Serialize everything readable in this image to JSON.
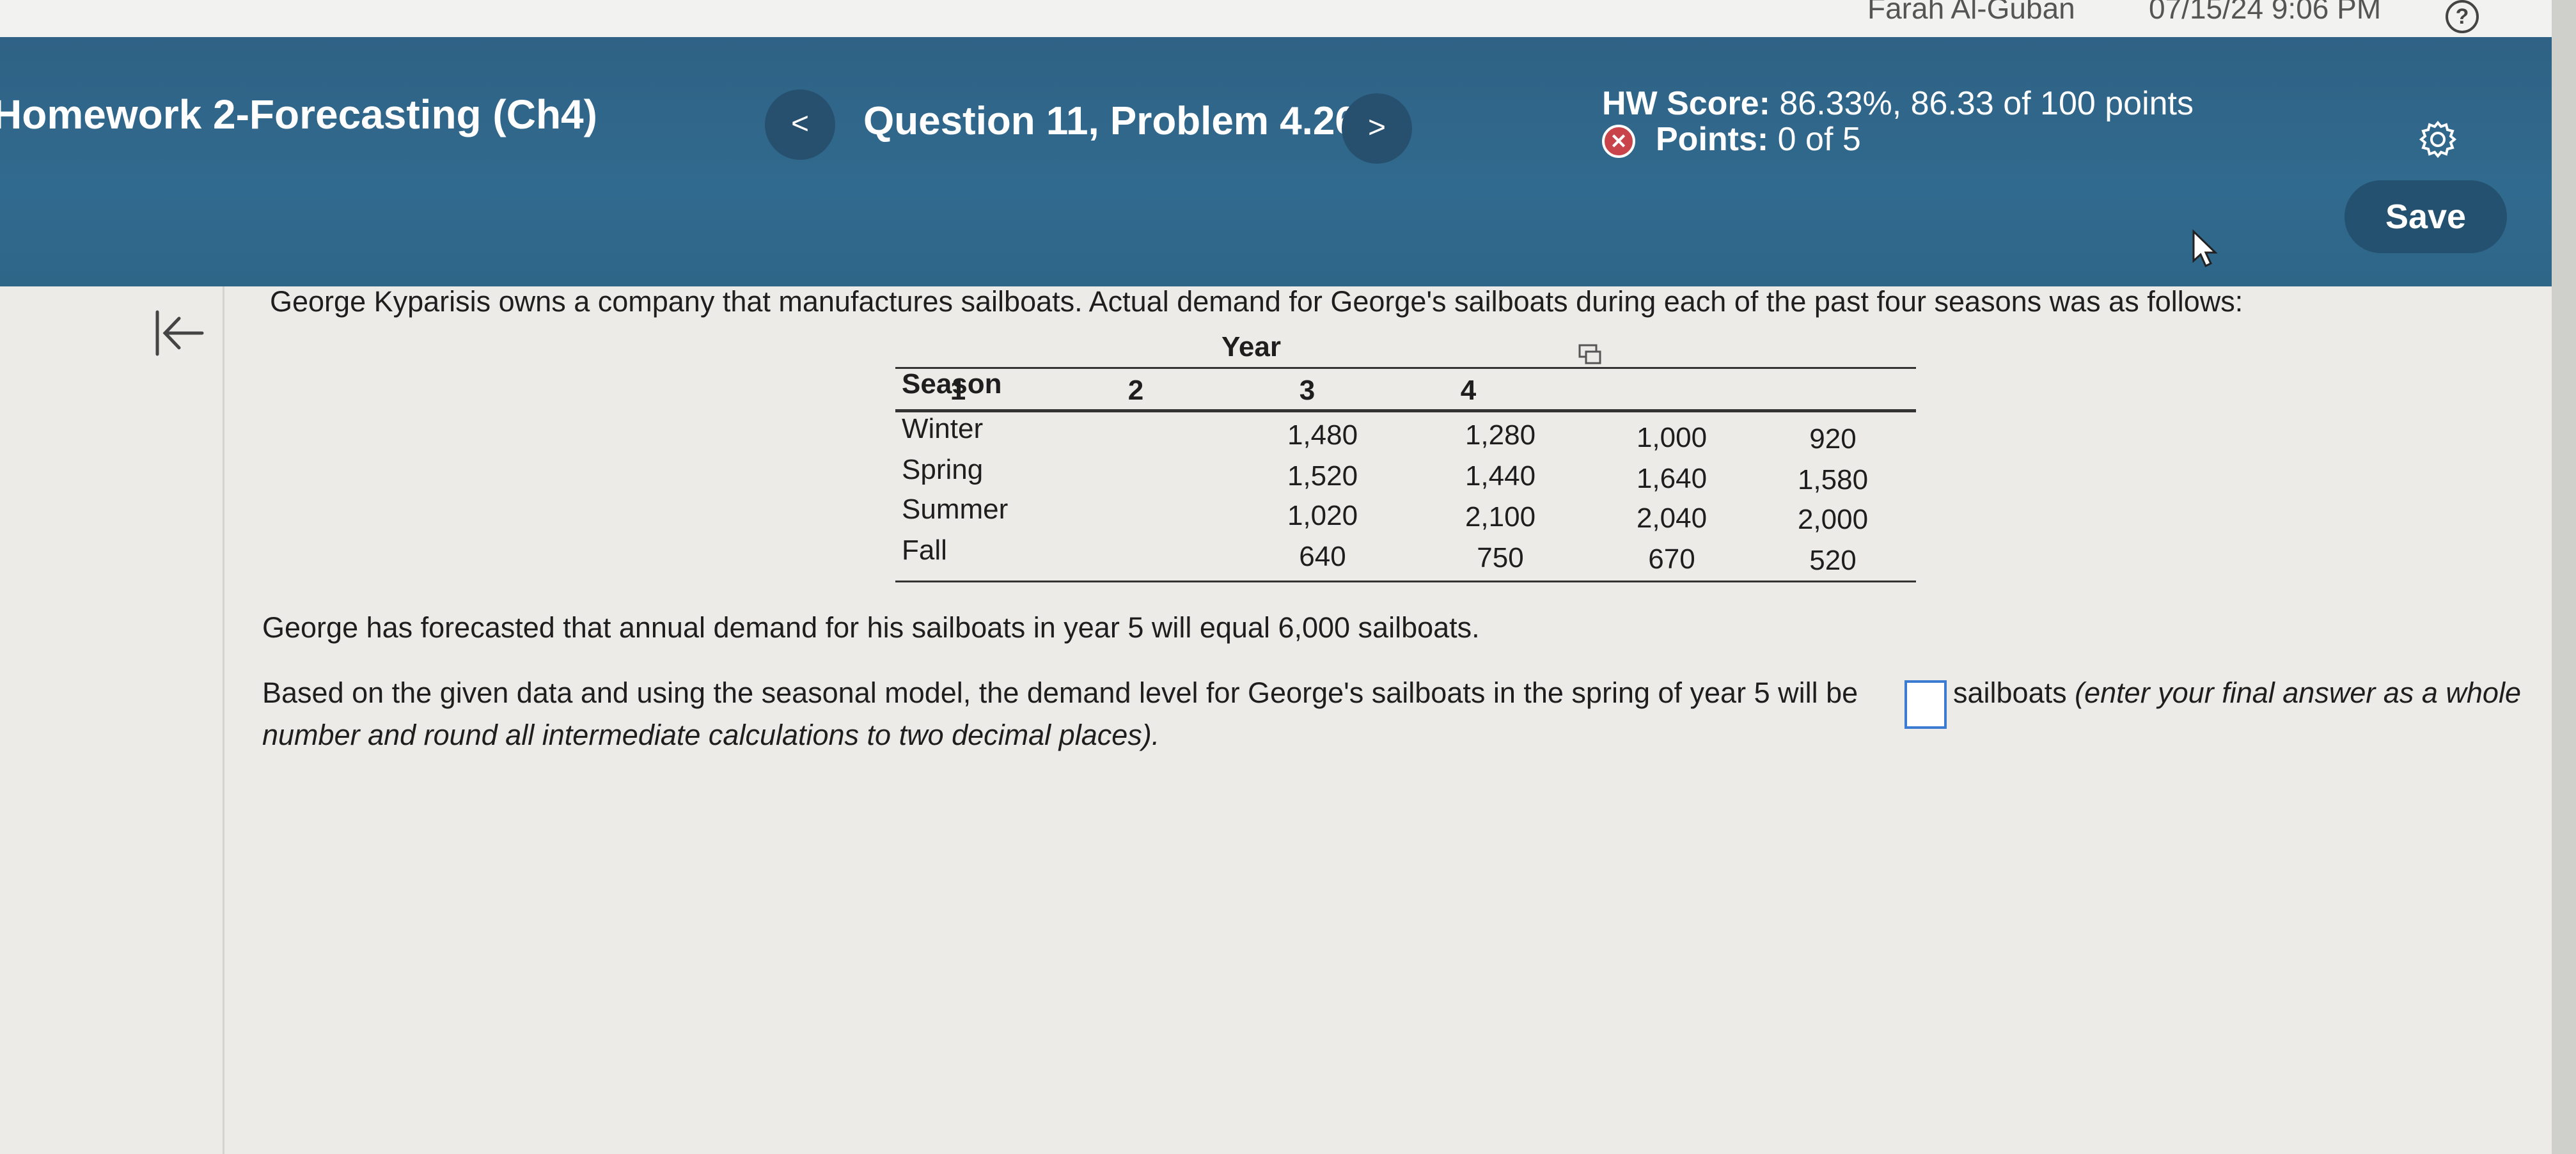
{
  "system": {
    "user_name": "Farah Al-Guban",
    "datetime": "07/15/24 9:06 PM",
    "help_label": "?"
  },
  "header": {
    "assignment_title": "Homework 2-Forecasting (Ch4)",
    "prev_label": "<",
    "next_label": ">",
    "question_title": "Question 11, Problem 4.26",
    "hw_score_label": "HW Score:",
    "hw_score_value": "86.33%, 86.33 of 100 points",
    "points_label": "Points:",
    "points_value": "0 of 5",
    "save_label": "Save"
  },
  "problem": {
    "intro": "George Kyparisis owns a company that manufactures sailboats. Actual demand for George's sailboats during each of the past four seasons was as follows:",
    "table": {
      "year_header": "Year",
      "season_header": "Season",
      "years": [
        "1",
        "2",
        "3",
        "4"
      ],
      "rows": [
        {
          "season": "Winter",
          "values": [
            "1,480",
            "1,280",
            "1,000",
            "920"
          ]
        },
        {
          "season": "Spring",
          "values": [
            "1,520",
            "1,440",
            "1,640",
            "1,580"
          ]
        },
        {
          "season": "Summer",
          "values": [
            "1,020",
            "2,100",
            "2,040",
            "2,000"
          ]
        },
        {
          "season": "Fall",
          "values": [
            "640",
            "750",
            "670",
            "520"
          ]
        }
      ]
    },
    "forecast_statement": "George has forecasted that annual demand for his sailboats in year 5 will equal 6,000 sailboats.",
    "question_before": "Based on the given data and using the seasonal model, the demand level for George's sailboats in the spring of year 5 will be",
    "question_unit": "sailboats",
    "question_note_line1": "(enter your final answer as a whole",
    "question_note_line2": "number and round all intermediate calculations to two decimal places).",
    "answer_value": ""
  }
}
